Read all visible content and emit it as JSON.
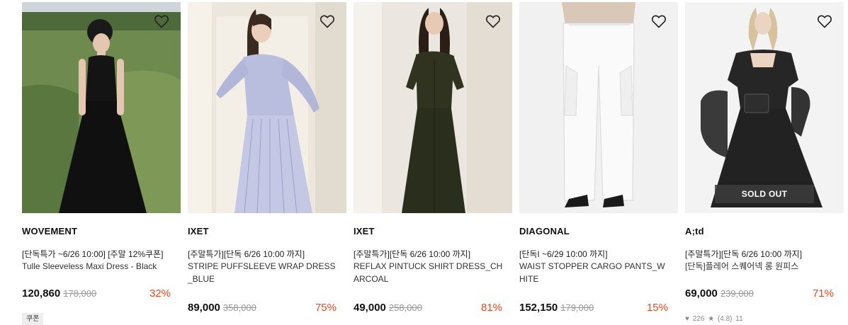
{
  "products": [
    {
      "brand": "WOVEMENT",
      "promo": "[단독특가 ~6/26 10:00] [주말 12%쿠폰]",
      "name": "Tulle Sleeveless Maxi Dress - Black",
      "price": "120,860",
      "original_price": "178,000",
      "discount": "32%",
      "badge": "쿠폰",
      "wishlisted": false
    },
    {
      "brand": "IXET",
      "promo": "[주말특가][단독 6/26 10:00 까지]",
      "name": "STRIPE PUFFSLEEVE WRAP DRESS_BLUE",
      "price": "89,000",
      "original_price": "358,000",
      "discount": "75%",
      "wishlisted": false
    },
    {
      "brand": "IXET",
      "promo": "[주말특가][단독 6/26 10:00 까지]",
      "name": "REFLAX PINTUCK SHIRT DRESS_CHARCOAL",
      "price": "49,000",
      "original_price": "258,000",
      "discount": "81%",
      "wishlisted": false
    },
    {
      "brand": "DIAGONAL",
      "promo": "[단독I ~6/29 10:00 까지]",
      "name": "WAIST STOPPER CARGO PANTS_WHITE",
      "price": "152,150",
      "original_price": "179,000",
      "discount": "15%",
      "wishlisted": false
    },
    {
      "brand": "A;td",
      "promo": "[주말특가][단독 6/26 10:00 까지]",
      "name": "[단독]플레어 스퀘어넥 롱 원피스",
      "price": "69,000",
      "original_price": "239,000",
      "discount": "71%",
      "status": "SOLD OUT",
      "likes": "226",
      "rating": "(4.8)",
      "reviews": "11",
      "wishlisted": false
    }
  ],
  "icons": {
    "wishlist": "heart-outline-icon",
    "likes": "heart-filled-icon",
    "rating": "star-icon"
  },
  "colors": {
    "discount": "#f0461e",
    "soldout_bg": "#3c3c3c"
  }
}
